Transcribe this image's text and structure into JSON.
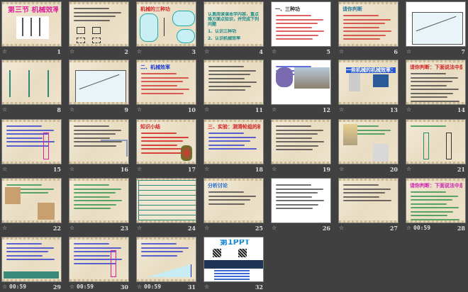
{
  "view": "slide-sorter",
  "animation_icon": "star-animation-icon",
  "slides": [
    {
      "number": "1",
      "bg": "parch",
      "title": "第三节 机械效率",
      "title_color": "#e0209a",
      "fig": "pulleys",
      "lines": 0,
      "line_color": "#444"
    },
    {
      "number": "2",
      "bg": "parch",
      "title": "",
      "fig": "boxes",
      "lines": 4,
      "line_color": "#333"
    },
    {
      "number": "3",
      "bg": "parch",
      "title": "机械的三种功",
      "title_color": "#d42020",
      "fig": "clouds",
      "lines": 0,
      "line_color": "#c00"
    },
    {
      "number": "4",
      "bg": "parch",
      "title": "认真阅读课本学内容，重点难方面点知识，并完成下列问题",
      "title_color": "#1a8a8a",
      "fig": "none",
      "lines": 0,
      "line_color": "#1a8a8a",
      "items": [
        "1、认识三种功",
        "2、认识机械效率"
      ]
    },
    {
      "number": "5",
      "bg": "white",
      "title": "一、三种功",
      "title_color": "#222",
      "fig": "none",
      "lines": 7,
      "line_color": "#d02020"
    },
    {
      "number": "6",
      "bg": "parch",
      "title": "请你判断",
      "title_color": "#2a7a9a",
      "fig": "none",
      "lines": 7,
      "line_color": "#d02020"
    },
    {
      "number": "7",
      "bg": "white",
      "title": "",
      "fig": "stairs",
      "lines": 0,
      "line_color": "#c00"
    },
    {
      "number": "8",
      "bg": "parch",
      "title": "",
      "fig": "tree",
      "lines": 0,
      "line_color": "#333"
    },
    {
      "number": "9",
      "bg": "parch",
      "title": "",
      "fig": "stairs",
      "lines": 0,
      "line_color": "#c00"
    },
    {
      "number": "10",
      "bg": "parch",
      "title": "二、机械效率",
      "title_color": "#1a3ad0",
      "fig": "none",
      "lines": 6,
      "line_color": "#d02020"
    },
    {
      "number": "11",
      "bg": "parch",
      "title": "",
      "fig": "none",
      "lines": 7,
      "line_color": "#333"
    },
    {
      "number": "12",
      "bg": "white",
      "title": "",
      "fig": "crane",
      "lines": 3,
      "line_color": "#2030d0"
    },
    {
      "number": "13",
      "bg": "parch",
      "title": "一些机械的机械效率：",
      "title_color": "#fff",
      "fig": "machines",
      "lines": 0,
      "line_color": "#333"
    },
    {
      "number": "14",
      "bg": "parch",
      "title": "请你判断：下面说法中是否正确？",
      "title_color": "#d02020",
      "fig": "none",
      "lines": 8,
      "line_color": "#333"
    },
    {
      "number": "15",
      "bg": "parch",
      "title": "",
      "fig": "pulley-pink",
      "lines": 6,
      "line_color": "#1a2ad0"
    },
    {
      "number": "16",
      "bg": "parch",
      "title": "",
      "fig": "lever",
      "lines": 6,
      "line_color": "#333"
    },
    {
      "number": "17",
      "bg": "parch",
      "title": "知识小结",
      "title_color": "#d42020",
      "fig": "flowers",
      "lines": 6,
      "line_color": "#c00"
    },
    {
      "number": "18",
      "bg": "parch",
      "title": "三、实验：测滑轮组的机械效率",
      "title_color": "#d42020",
      "fig": "none",
      "lines": 5,
      "line_color": "#1a2ad0"
    },
    {
      "number": "19",
      "bg": "parch",
      "title": "",
      "fig": "none",
      "lines": 7,
      "line_color": "#333"
    },
    {
      "number": "20",
      "bg": "parch",
      "title": "",
      "fig": "photo2",
      "lines": 3,
      "line_color": "#1a8a3a"
    },
    {
      "number": "21",
      "bg": "parch",
      "title": "",
      "fig": "pulley2",
      "lines": 1,
      "line_color": "#1a8a3a"
    },
    {
      "number": "22",
      "bg": "parch",
      "title": "",
      "fig": "photo-pulley",
      "lines": 3,
      "line_color": "#1a8a3a"
    },
    {
      "number": "23",
      "bg": "parch",
      "title": "",
      "fig": "none",
      "lines": 7,
      "line_color": "#1a8a3a"
    },
    {
      "number": "24",
      "bg": "parch",
      "title": "",
      "fig": "table",
      "lines": 0,
      "line_color": "#333"
    },
    {
      "number": "25",
      "bg": "parch",
      "title": "分析讨论",
      "title_color": "#1a6ad0",
      "fig": "none",
      "lines": 4,
      "line_color": "#333"
    },
    {
      "number": "26",
      "bg": "white",
      "title": "",
      "fig": "none",
      "lines": 7,
      "line_color": "#333"
    },
    {
      "number": "27",
      "bg": "parch",
      "title": "",
      "fig": "none",
      "lines": 5,
      "line_color": "#333"
    },
    {
      "number": "28",
      "bg": "parch",
      "title": "请你判断：下面说法中是否正确？",
      "title_color": "#d020b0",
      "fig": "none",
      "lines": 8,
      "line_color": "#1a8a3a",
      "time": "00:59"
    },
    {
      "number": "29",
      "bg": "parch",
      "title": "",
      "fig": "ramp-machine",
      "lines": 5,
      "line_color": "#1a2ad0",
      "time": "00:59"
    },
    {
      "number": "30",
      "bg": "parch",
      "title": "",
      "fig": "pulley-pink",
      "lines": 6,
      "line_color": "#1a2ad0",
      "time": "00:59"
    },
    {
      "number": "31",
      "bg": "parch",
      "title": "",
      "fig": "ramp",
      "lines": 4,
      "line_color": "#1a2ad0",
      "time": "00:59"
    },
    {
      "number": "32",
      "bg": "white",
      "title": "第1PPT",
      "title_color": "#1a8ad0",
      "fig": "ppt-ad",
      "lines": 0,
      "line_color": "#333"
    }
  ]
}
